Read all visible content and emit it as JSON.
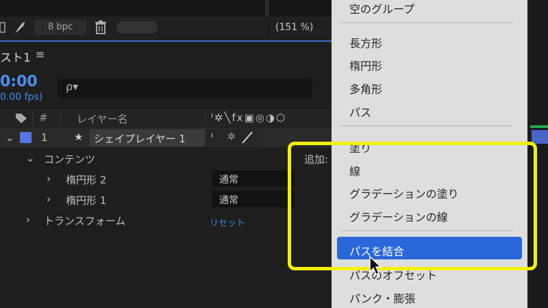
{
  "toolbar": {
    "bpc_label": "8 bpc",
    "zoom_label": "(151 %)"
  },
  "timeline": {
    "tab_title": "スト1",
    "menu_icon": "≡",
    "timecode": "0:00",
    "fps": "0.00 fps)",
    "search_icon": "ρ▾",
    "header": {
      "hash": "#",
      "layer_name": "レイヤー名",
      "switch_icons": "ᑊ✲╲fx▣◎◑⬡"
    },
    "layers": [
      {
        "number": "1",
        "star": "★",
        "name": "シェイプレイヤー 1",
        "color": "#5576e6"
      }
    ],
    "contents_label": "コンテンツ",
    "add_label": "追加:",
    "shape_items": [
      {
        "label": "楕円形 2",
        "mode": "通常"
      },
      {
        "label": "楕円形 1",
        "mode": "通常"
      }
    ],
    "transform_label": "トランスフォーム",
    "reset_label": "リセット"
  },
  "menu": {
    "group_top": [
      "空のグループ"
    ],
    "shapes": [
      "長方形",
      "楕円形",
      "多角形",
      "パス"
    ],
    "styles": [
      "塗り",
      "線",
      "グラデーションの塗り",
      "グラデーションの線"
    ],
    "operators": [
      "パスを結合",
      "パスのオフセット",
      "パンク・膨張"
    ],
    "selected_index": 0
  },
  "colors": {
    "accent_blue": "#2a67d8",
    "annotation_yellow": "#f3f00b",
    "timecode_blue": "#4a8ff0",
    "label_color": "#5576e6"
  }
}
